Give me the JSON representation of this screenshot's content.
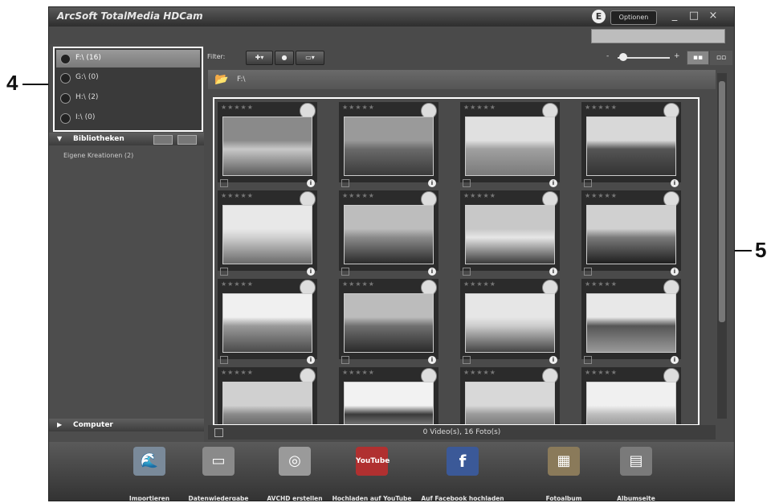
{
  "window": {
    "title": "ArcSoft TotalMedia HDCam",
    "options_label": "Optionen",
    "logo_letter": "E"
  },
  "callouts": {
    "drives": "4",
    "grid": "5"
  },
  "sidebar": {
    "drives": [
      {
        "label": "F:\\ (16)"
      },
      {
        "label": "G:\\ (0)"
      },
      {
        "label": "H:\\ (2)"
      },
      {
        "label": "I:\\ (0)"
      }
    ],
    "library_header": "Bibliotheken",
    "library_item": "Eigene Kreationen (2)",
    "computer_header": "Computer"
  },
  "toolbar": {
    "filter_label": "Filter:",
    "zoom_min": "-",
    "zoom_max": "+"
  },
  "path": {
    "text": "F:\\"
  },
  "status": {
    "text": "0 Video(s), 16 Foto(s)"
  },
  "actions": [
    {
      "label": "Importieren"
    },
    {
      "label": "Datenwiedergabe"
    },
    {
      "label": "AVCHD erstellen"
    },
    {
      "label": "Hochladen auf YouTube",
      "icon_text": "YouTube"
    },
    {
      "label": "Auf Facebook hochladen",
      "icon_text": "f"
    },
    {
      "label": "Fotoalbum"
    },
    {
      "label": "Albumseite"
    }
  ],
  "photos": [
    {
      "colors": [
        "#8a8a8a",
        "#c8c8c8",
        "#5a5a5a"
      ]
    },
    {
      "colors": [
        "#9a9a9a",
        "#6a6a6a",
        "#3a3a3a"
      ]
    },
    {
      "colors": [
        "#e0e0e0",
        "#a0a0a0",
        "#7a7a7a"
      ]
    },
    {
      "colors": [
        "#d8d8d8",
        "#555555",
        "#333333"
      ]
    },
    {
      "colors": [
        "#e8e8e8",
        "#cfcfcf",
        "#6a6a6a"
      ]
    },
    {
      "colors": [
        "#bdbdbd",
        "#8a8a8a",
        "#2a2a2a"
      ]
    },
    {
      "colors": [
        "#c8c8c8",
        "#e6e6e6",
        "#3a3a3a"
      ]
    },
    {
      "colors": [
        "#d0d0d0",
        "#7a7a7a",
        "#1e1e1e"
      ]
    },
    {
      "colors": [
        "#f0f0f0",
        "#9a9a9a",
        "#4a4a4a"
      ]
    },
    {
      "colors": [
        "#bcbcbc",
        "#707070",
        "#2a2a2a"
      ]
    },
    {
      "colors": [
        "#e6e6e6",
        "#cccccc",
        "#444444"
      ]
    },
    {
      "colors": [
        "#e8e8e8",
        "#555555",
        "#9a9a9a"
      ]
    },
    {
      "colors": [
        "#d0d0d0",
        "#8a8a8a",
        "#333333"
      ]
    },
    {
      "colors": [
        "#f2f2f2",
        "#3a3a3a",
        "#c8c8c8"
      ]
    },
    {
      "colors": [
        "#d8d8d8",
        "#9a9a9a",
        "#505050"
      ]
    },
    {
      "colors": [
        "#f0f0f0",
        "#bdbdbd",
        "#6a6a6a"
      ]
    }
  ]
}
